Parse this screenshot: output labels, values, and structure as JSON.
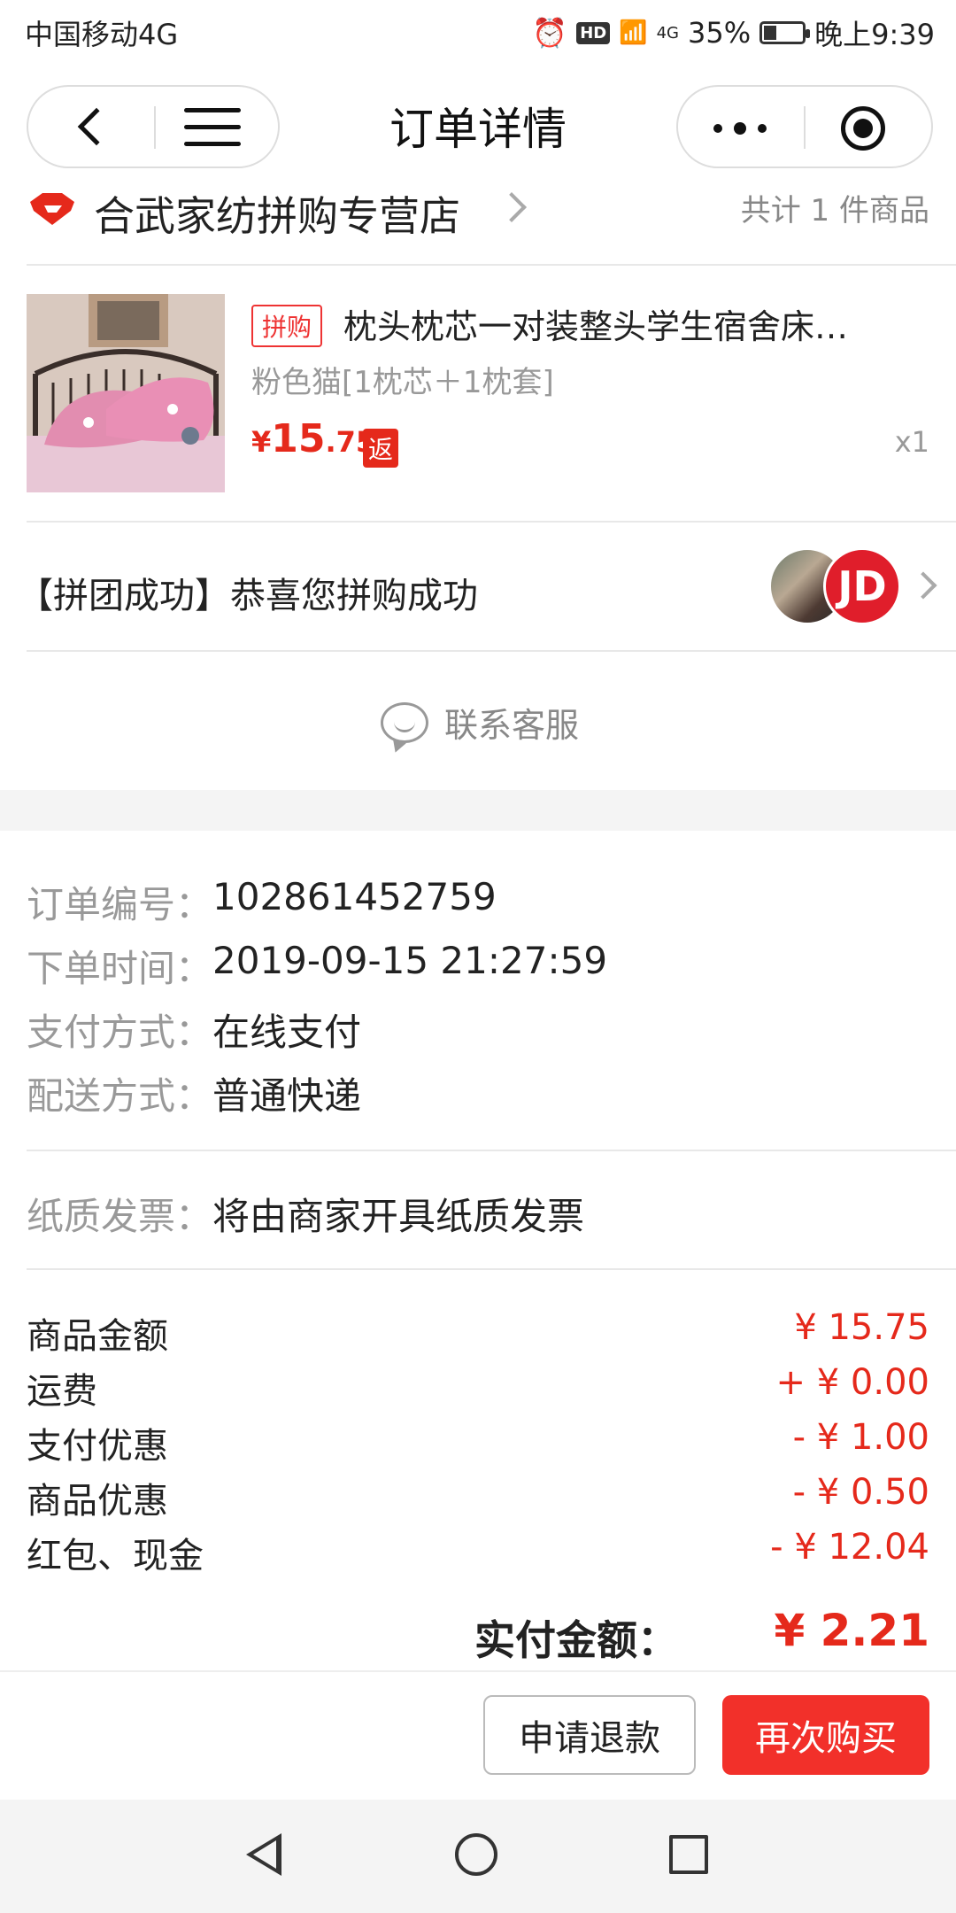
{
  "status_bar": {
    "carrier": "中国移动4G",
    "hd": "HD",
    "network": "4G",
    "battery": "35%",
    "battery_level": 0.35,
    "time": "晚上9:39"
  },
  "nav": {
    "title": "订单详情"
  },
  "store": {
    "name": "合武家纺拼购专营店",
    "item_count": "共计 1 件商品"
  },
  "product": {
    "tag": "拼购",
    "title": "枕头枕芯一对装整头学生宿舍床…",
    "spec": "粉色猫[1枕芯＋1枕套]",
    "price_currency": "¥",
    "price_int": "15",
    "price_dec": ".75",
    "rebate_tag": "返",
    "qty": "x1"
  },
  "group": {
    "text": "【拼团成功】恭喜您拼购成功",
    "avatar2_text": "JD"
  },
  "service": {
    "label": "联系客服"
  },
  "order_info": {
    "rows": [
      {
        "label": "订单编号：",
        "value": "102861452759"
      },
      {
        "label": "下单时间：",
        "value": "2019-09-15 21:27:59"
      },
      {
        "label": "支付方式：",
        "value": "在线支付"
      },
      {
        "label": "配送方式：",
        "value": "普通快递"
      }
    ],
    "invoice": {
      "label": "纸质发票：",
      "value": "将由商家开具纸质发票"
    }
  },
  "amounts": {
    "rows": [
      {
        "label": "商品金额",
        "value": "¥ 15.75"
      },
      {
        "label": "运费",
        "value": "+ ¥ 0.00"
      },
      {
        "label": "支付优惠",
        "value": "- ¥ 1.00"
      },
      {
        "label": "商品优惠",
        "value": "- ¥ 0.50"
      },
      {
        "label": "红包、现金",
        "value": "- ¥ 12.04"
      }
    ],
    "total_label": "实付金额：",
    "total_value": "¥ 2.21"
  },
  "actions": {
    "refund": "申请退款",
    "rebuy": "再次购买"
  },
  "colors": {
    "accent": "#e5291b",
    "button_primary": "#f2302a"
  }
}
